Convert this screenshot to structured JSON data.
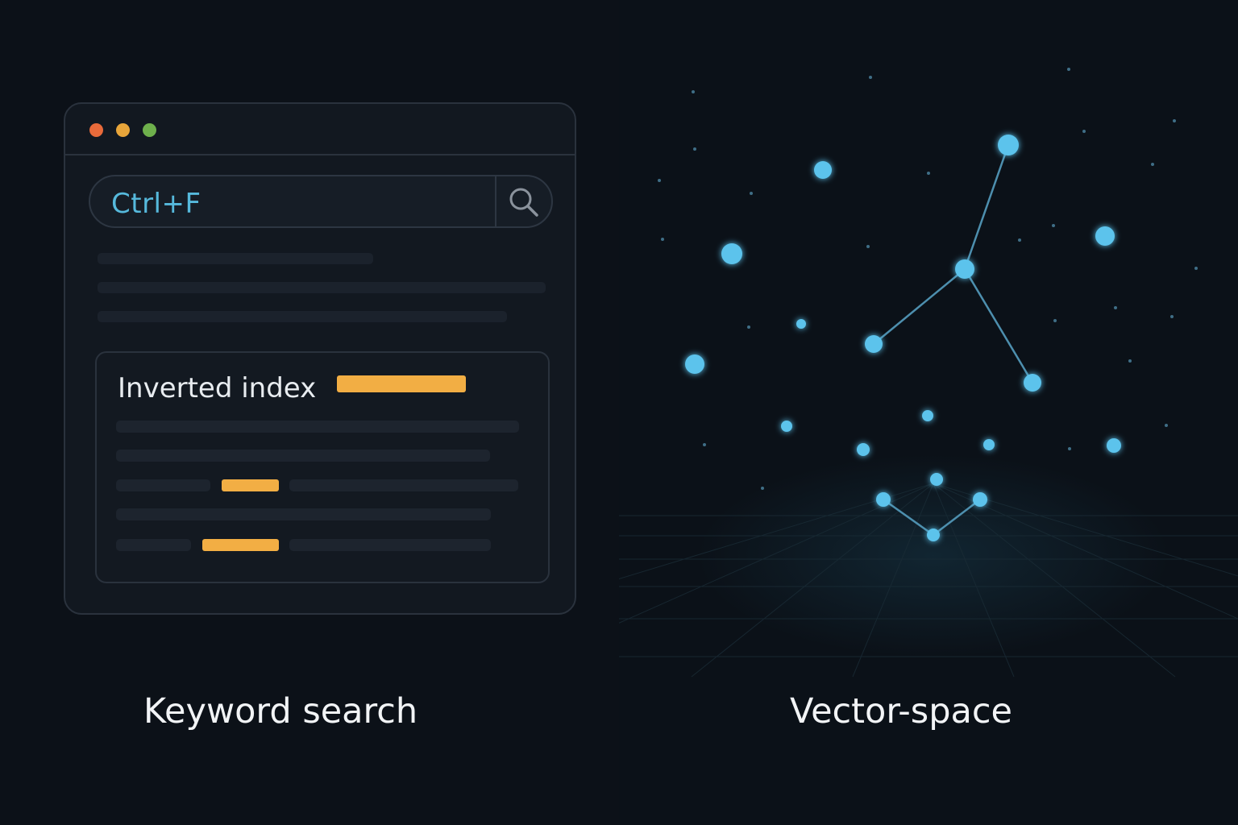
{
  "keyword_panel": {
    "search_text": "Ctrl+F",
    "card_title": "Inverted index",
    "caption": "Keyword search",
    "search_icon": "magnifier-icon",
    "highlight_color": "#f2ae44",
    "query_color": "#56b9dc"
  },
  "vector_panel": {
    "caption": "Vector-space",
    "node_color": "#5cc3ec",
    "nodes": [
      {
        "id": "n1"
      },
      {
        "id": "n2"
      },
      {
        "id": "n3"
      },
      {
        "id": "n4"
      },
      {
        "id": "n5"
      },
      {
        "id": "n6"
      },
      {
        "id": "n7"
      },
      {
        "id": "n8"
      },
      {
        "id": "n9"
      },
      {
        "id": "n10"
      },
      {
        "id": "n11"
      },
      {
        "id": "n12"
      },
      {
        "id": "n13"
      },
      {
        "id": "n14"
      },
      {
        "id": "n15"
      },
      {
        "id": "n16"
      },
      {
        "id": "n17"
      },
      {
        "id": "n18"
      },
      {
        "id": "n19"
      },
      {
        "id": "n20"
      }
    ],
    "edges": [
      [
        "n2",
        "n6"
      ],
      [
        "n6",
        "n7"
      ],
      [
        "n6",
        "n9"
      ],
      [
        "n17",
        "n19"
      ],
      [
        "n19",
        "n18"
      ]
    ]
  }
}
